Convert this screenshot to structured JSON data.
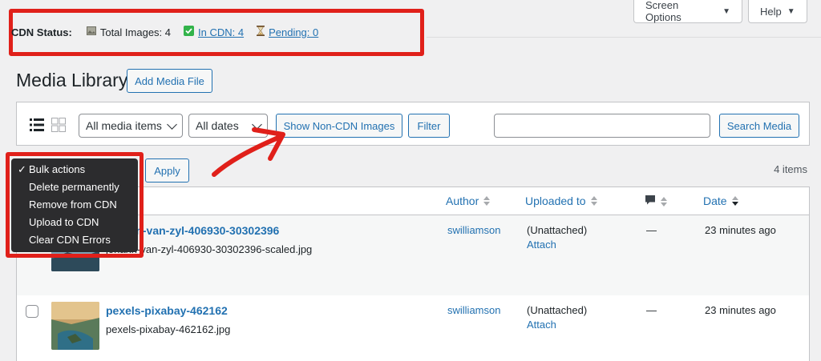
{
  "cdn_status": {
    "label": "CDN Status:",
    "total_images": "Total Images: 4",
    "in_cdn": "In CDN: 4",
    "pending": "Pending: 0"
  },
  "top_tabs": {
    "screen_options": "Screen Options",
    "help": "Help"
  },
  "page": {
    "title": "Media Library",
    "add_media_label": "Add Media File"
  },
  "filters": {
    "media_type_selected": "All media items",
    "dates_selected": "All dates",
    "show_non_cdn_label": "Show Non-CDN Images",
    "filter_label": "Filter",
    "search_value": "",
    "search_button_label": "Search Media"
  },
  "bulk_actions": {
    "options": [
      "Bulk actions",
      "Delete permanently",
      "Remove from CDN",
      "Upload to CDN",
      "Clear CDN Errors"
    ],
    "selected_index": 0,
    "apply_label": "Apply"
  },
  "items_count": "4 items",
  "table": {
    "columns": {
      "author": "Author",
      "uploaded_to": "Uploaded to",
      "date": "Date"
    },
    "rows": [
      {
        "title": "johann-van-zyl-406930-30302396",
        "filename": "johann-van-zyl-406930-30302396-scaled.jpg",
        "author": "swilliamson",
        "uploaded_to": "(Unattached)",
        "attach_label": "Attach",
        "comments": "—",
        "date": "23 minutes ago"
      },
      {
        "title": "pexels-pixabay-462162",
        "filename": "pexels-pixabay-462162.jpg",
        "author": "swilliamson",
        "uploaded_to": "(Unattached)",
        "attach_label": "Attach",
        "comments": "—",
        "date": "23 minutes ago"
      }
    ]
  },
  "colors": {
    "accent": "#2271b1",
    "highlight": "#e0201a",
    "menu_bg": "#2c2c2e"
  }
}
